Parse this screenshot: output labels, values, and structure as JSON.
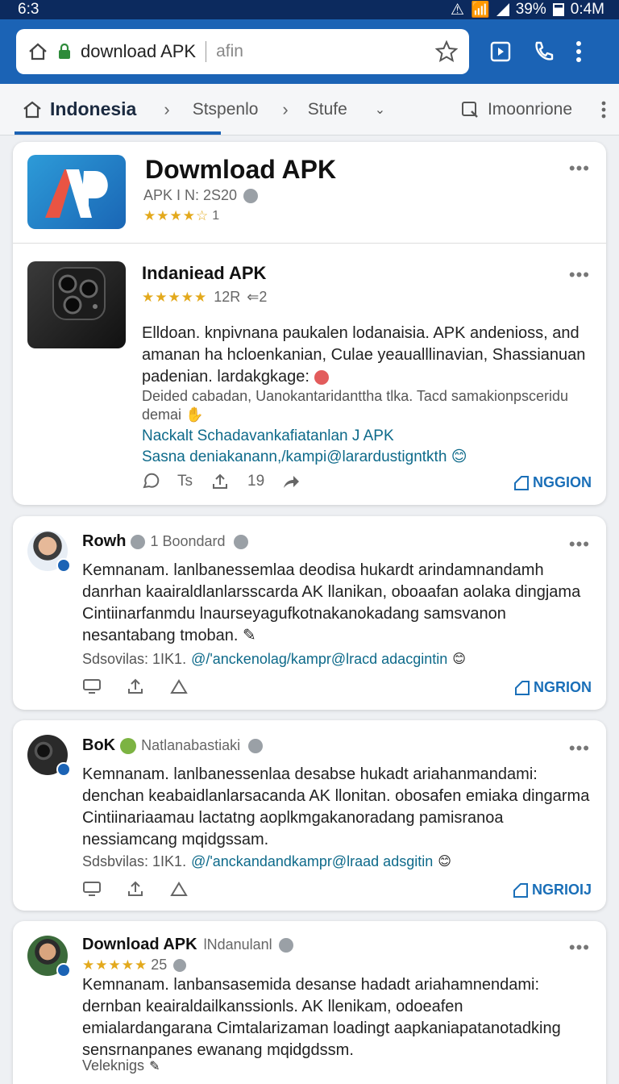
{
  "status_bar": {
    "time_left": "6:3",
    "battery": "39%",
    "time_right": "0:4M"
  },
  "browser": {
    "url": "download APK",
    "hint": "afin"
  },
  "nav": {
    "home": "Indonesia",
    "crumb1": "Stspenlo",
    "crumb2": "Stufe",
    "action": "Imoonrione"
  },
  "app_header": {
    "title": "Dowmload APK",
    "meta": "APK I N: 2S20",
    "stars": "★★★★☆",
    "rating": "1"
  },
  "featured": {
    "title": "Indaniead APK",
    "stars": "★★★★★",
    "count": "12R",
    "extra": "2",
    "body": "Elldoan. knpivnana paukalen lodanaisia. APK andenioss, and amanan ha hcloenkanian, Culae yeaualllinavian, Shassianuan padenian. lardakgkage:",
    "sub": "Deided cabadan, Uanokantaridanttha tlka. Tacd samakionpsceridu demai",
    "link1": "Nackalt Schadavankafiatanlan J APK",
    "link2": "Sasna deniakanann,/kampi@larardustigntkth",
    "action_ts": "Ts",
    "action_count": "19",
    "region": "NGGION"
  },
  "posts": [
    {
      "author": "Rowh",
      "sub": "1 Boondard",
      "body": "Kemnanam. lanlbanessemlaa deodisa hukardt arindamnandamh danrhan kaairaldlanlarsscarda AK llanikan, oboaafan aolaka dingjama Cintiinarfanmdu lnaurseyagufkotnakanokadang samsvanon nesantabang tmoban.",
      "meta": "Sdsovilas: 1IK1.",
      "link": "@/'anckenolag/kampr@lracd adacgintin",
      "region": "NGRION"
    },
    {
      "author": "BoK",
      "sub": "Natlanabastiaki",
      "body": "Kemnanam. lanlbanessenlaa desabse hukadt ariahanmandami: denchan keabaidlanlarsacanda AK llonitan. obosafen emiaka dingarma Cintiinariaamau lactatng aoplkmgakanoradang pamisranoa nessiamcang mqidgssam.",
      "meta": "Sdsbvilas: 1IK1.",
      "link": "@/'anckandandkampr@lraad adsgitin",
      "region": "NGRIOIJ"
    },
    {
      "author": "Download APK",
      "sub": "lNdanulanl",
      "stars": "★★★★★",
      "count": "25",
      "body": "Kemnanam. lanbansasemida desanse hadadt ariahamnendami: dernban keairaldailkanssionls. AK llenikam, odoeafen emialardangarana Cimtalarizaman loadingt aapkaniapatanotadking sensrnanpanes ewanang mqidgdssm.",
      "meta": "Veleknigs"
    }
  ],
  "colors": {
    "accent": "#1b63b5",
    "status": "#0c2a5e",
    "star": "#e3a91c",
    "link": "#0e6a8a"
  }
}
